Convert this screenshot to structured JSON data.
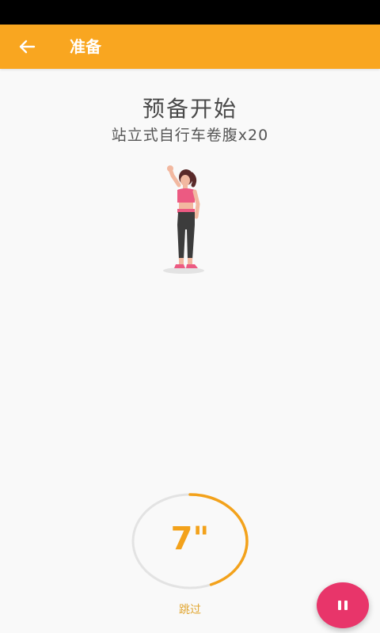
{
  "app_bar": {
    "title": "准备",
    "back_icon": "arrow-left-icon"
  },
  "main": {
    "heading": "预备开始",
    "exercise": "站立式自行车卷腹x20"
  },
  "timer": {
    "value": "7\"",
    "progress_fraction": 0.44
  },
  "skip": {
    "label": "跳过"
  },
  "fab": {
    "icon": "pause-icon"
  },
  "colors": {
    "accent": "#f9a620",
    "timer_text": "#f3a21b",
    "fab": "#e8356a"
  }
}
